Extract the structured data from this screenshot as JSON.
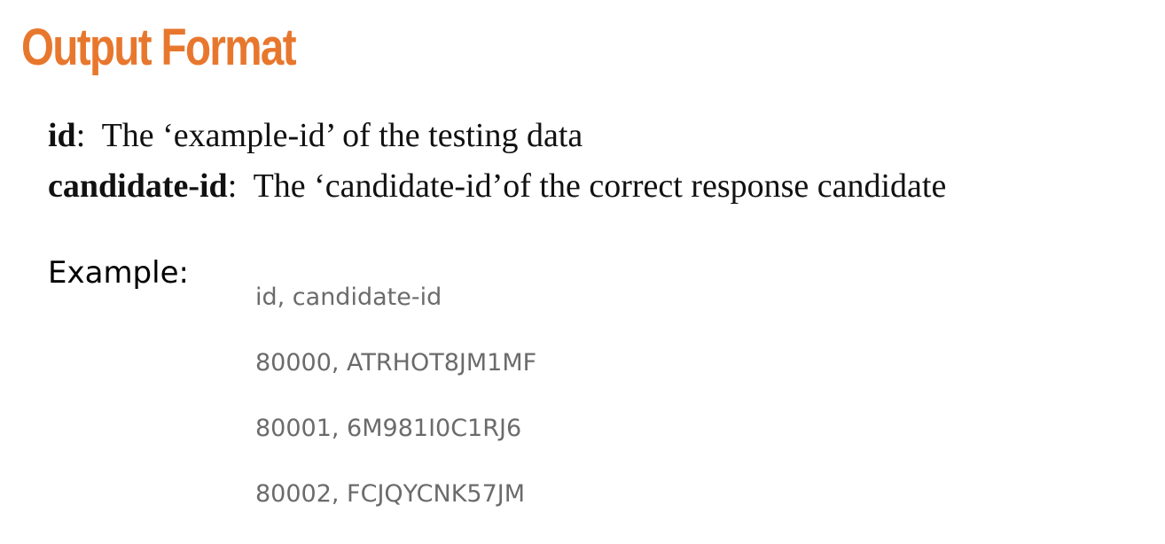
{
  "colors": {
    "title": "#E8772E",
    "text": "#111111",
    "example_text": "#6b6b6b"
  },
  "header": {
    "title": "Output Format"
  },
  "definitions": [
    {
      "term": "id",
      "separator": ":",
      "description": "  The ‘example-id’ of the testing data"
    },
    {
      "term": "candidate-id",
      "separator": ":",
      "description": "  The ‘candidate-id’of the correct response candidate"
    }
  ],
  "example": {
    "label": "Example:",
    "lines": [
      "id, candidate-id",
      "80000, ATRHOT8JM1MF",
      "80001, 6M981I0C1RJ6",
      "80002, FCJQYCNK57JM"
    ]
  }
}
